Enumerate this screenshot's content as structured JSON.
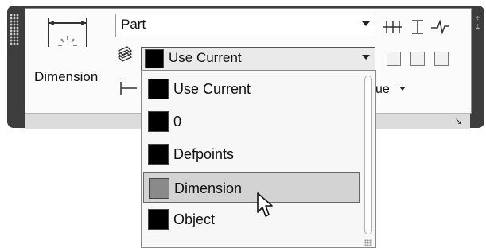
{
  "toolbar": {
    "dimension_label": "Dimension",
    "dim_style_value": "Part",
    "layer_value": "Use Current",
    "partial_label": "ue"
  },
  "dropdown": {
    "items": [
      {
        "label": "Use Current",
        "swatch": "#000000"
      },
      {
        "label": "0",
        "swatch": "#000000"
      },
      {
        "label": "Defpoints",
        "swatch": "#000000"
      },
      {
        "label": "Dimension",
        "swatch": "#8a8a8a",
        "highlighted": true
      },
      {
        "label": "Object",
        "swatch": "#000000"
      }
    ]
  },
  "icons": {
    "dimension": "dimension-icon",
    "layers": "layer-stack-icon",
    "cursor": "mouse-pointer-icon"
  },
  "colors": {
    "panel_dark": "#3d3d3d",
    "highlight": "#d3d3d3"
  }
}
